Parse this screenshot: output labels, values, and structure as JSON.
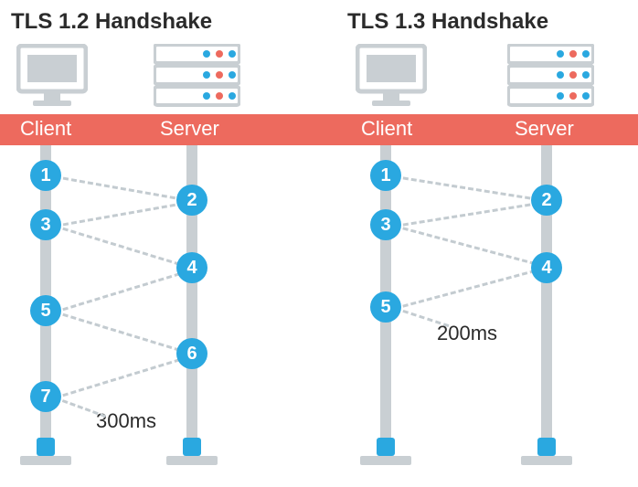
{
  "left": {
    "title": "TLS 1.2 Handshake",
    "client_label": "Client",
    "server_label": "Server",
    "steps": [
      "1",
      "2",
      "3",
      "4",
      "5",
      "6",
      "7"
    ],
    "timing": "300ms"
  },
  "right": {
    "title": "TLS 1.3 Handshake",
    "client_label": "Client",
    "server_label": "Server",
    "steps": [
      "1",
      "2",
      "3",
      "4",
      "5"
    ],
    "timing": "200ms"
  },
  "chart_data": [
    {
      "type": "sequence",
      "title": "TLS 1.2 Handshake",
      "actors": [
        "Client",
        "Server"
      ],
      "messages": [
        {
          "from": "Client",
          "to": "Server",
          "step": 1
        },
        {
          "from": "Server",
          "to": "Client",
          "step": 2
        },
        {
          "from": "Client",
          "to": "Server",
          "step": 3
        },
        {
          "from": "Server",
          "to": "Client",
          "step": 4
        },
        {
          "from": "Client",
          "to": "Server",
          "step": 5
        },
        {
          "from": "Server",
          "to": "Client",
          "step": 6
        },
        {
          "from": "Client",
          "to": "Server",
          "step": 7
        }
      ],
      "total_time_ms": 300
    },
    {
      "type": "sequence",
      "title": "TLS 1.3 Handshake",
      "actors": [
        "Client",
        "Server"
      ],
      "messages": [
        {
          "from": "Client",
          "to": "Server",
          "step": 1
        },
        {
          "from": "Server",
          "to": "Client",
          "step": 2
        },
        {
          "from": "Client",
          "to": "Server",
          "step": 3
        },
        {
          "from": "Server",
          "to": "Client",
          "step": 4
        },
        {
          "from": "Client",
          "to": "Server",
          "step": 5
        }
      ],
      "total_time_ms": 200
    }
  ]
}
